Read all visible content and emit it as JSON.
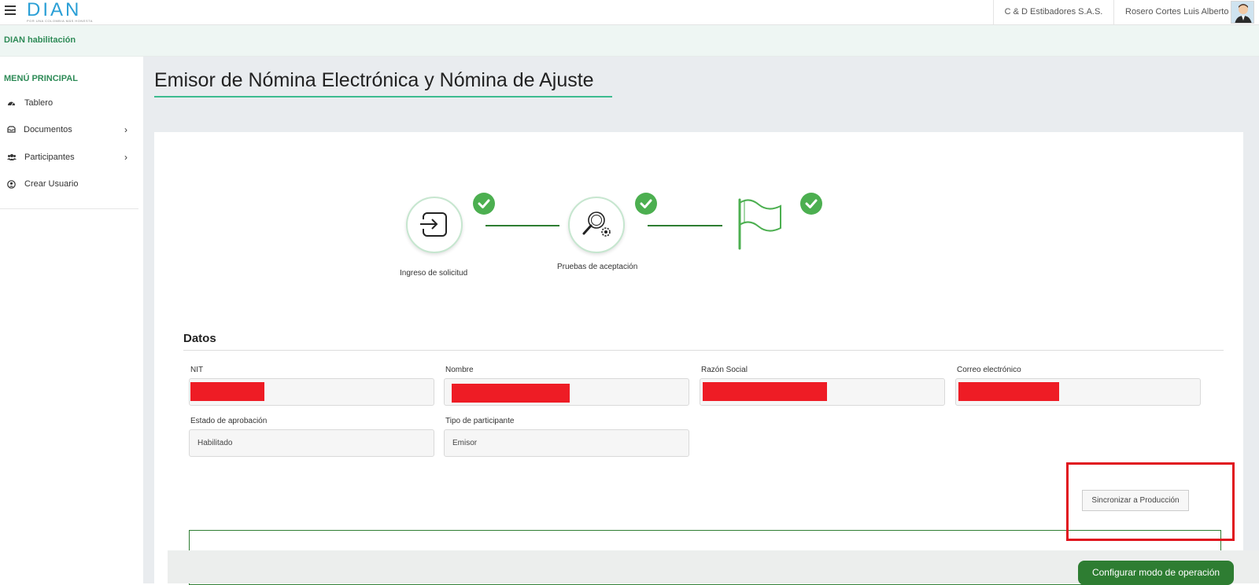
{
  "app": {
    "logo_text": "DIAN",
    "logo_subtitle": "POR UNA COLOMBIA MÁS HONESTA",
    "company": "C & D Estibadores S.A.S.",
    "user_name": "Rosero Cortes Luis Alberto"
  },
  "subheader": {
    "title": "DIAN habilitación"
  },
  "sidebar": {
    "title": "MENÚ PRINCIPAL",
    "items": [
      {
        "label": "Tablero",
        "icon": "dashboard-icon",
        "has_children": false
      },
      {
        "label": "Documentos",
        "icon": "inbox-icon",
        "has_children": true
      },
      {
        "label": "Participantes",
        "icon": "users-icon",
        "has_children": true
      },
      {
        "label": "Crear Usuario",
        "icon": "user-circle-icon",
        "has_children": false
      }
    ],
    "chevron": "›"
  },
  "page": {
    "title": "Emisor de Nómina Electrónica y Nómina de Ajuste"
  },
  "steps": [
    {
      "label": "Ingreso de solicitud",
      "icon": "sign-in-icon",
      "completed": true
    },
    {
      "label": "Pruebas de aceptación",
      "icon": "search-gear-icon",
      "completed": true
    },
    {
      "label": "",
      "icon": "flag-icon",
      "completed": true
    }
  ],
  "datos": {
    "title": "Datos",
    "fields": [
      {
        "label": "NIT",
        "value": "",
        "redacted": true
      },
      {
        "label": "Nombre",
        "value": "",
        "redacted": true
      },
      {
        "label": "Razón Social",
        "value": "",
        "redacted": true
      },
      {
        "label": "Correo electrónico",
        "value": "",
        "redacted": true
      },
      {
        "label": "Estado de aprobación",
        "value": "Habilitado",
        "redacted": false
      },
      {
        "label": "Tipo de participante",
        "value": "Emisor",
        "redacted": false
      }
    ]
  },
  "actions": {
    "sync_label": "Sincronizar a Producción",
    "configure_label": "Configurar modo de operación"
  },
  "colors": {
    "brand_green": "#2e7d32",
    "check_green": "#4caf50",
    "accent_underline": "#3dbb8f",
    "logo_blue": "#2a9fd6",
    "highlight_red": "#e0141e"
  }
}
